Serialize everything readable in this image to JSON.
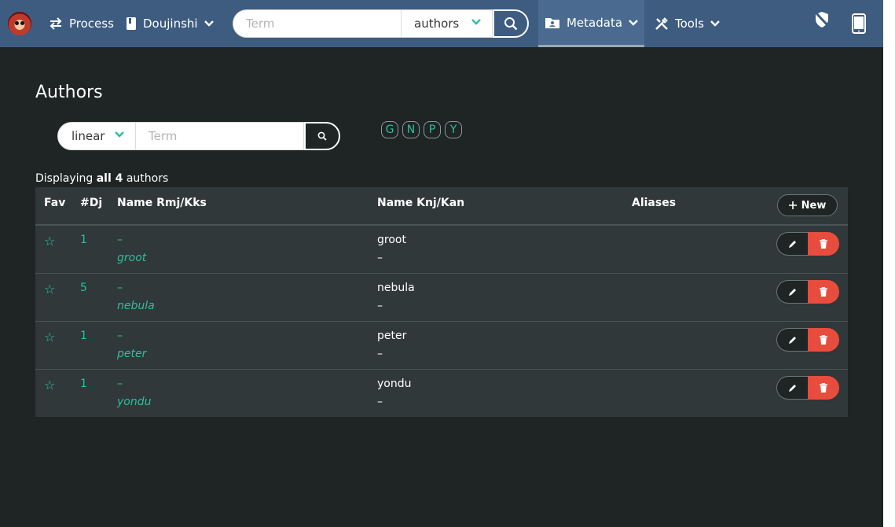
{
  "navbar": {
    "process_label": "Process",
    "doujinshi_label": "Doujinshi",
    "search": {
      "placeholder": "Term",
      "scope": "authors"
    },
    "metadata_label": "Metadata",
    "tools_label": "Tools"
  },
  "page": {
    "title": "Authors",
    "filter": {
      "mode": "linear",
      "placeholder": "Term"
    },
    "letters": [
      "G",
      "N",
      "P",
      "Y"
    ],
    "count": {
      "prefix": "Displaying ",
      "emph": "all 4",
      "suffix": " authors"
    }
  },
  "table": {
    "headers": {
      "fav": "Fav",
      "dj": "#Dj",
      "rmj": "Name Rmj/Kks",
      "knj": "Name Knj/Kan",
      "aliases": "Aliases"
    },
    "new_label": "New",
    "rows": [
      {
        "fav": "☆",
        "dj": "1",
        "rmj": "–",
        "kks": "groot",
        "knj": "groot",
        "kan": "–"
      },
      {
        "fav": "☆",
        "dj": "5",
        "rmj": "–",
        "kks": "nebula",
        "knj": "nebula",
        "kan": "–"
      },
      {
        "fav": "☆",
        "dj": "1",
        "rmj": "–",
        "kks": "peter",
        "knj": "peter",
        "kan": "–"
      },
      {
        "fav": "☆",
        "dj": "1",
        "rmj": "–",
        "kks": "yondu",
        "knj": "yondu",
        "kan": "–"
      }
    ]
  },
  "colors": {
    "navbar": "#3d5c80",
    "accent": "#2ac19a",
    "danger": "#e84c3d",
    "background": "#1f2424"
  },
  "icons": [
    "logo-icon",
    "swap-icon",
    "book-icon",
    "chevron-down-icon",
    "search-icon",
    "folder-user-icon",
    "tools-icon",
    "shield-off-icon",
    "tablet-icon",
    "plus-icon",
    "pencil-icon",
    "trash-icon",
    "star-icon"
  ]
}
